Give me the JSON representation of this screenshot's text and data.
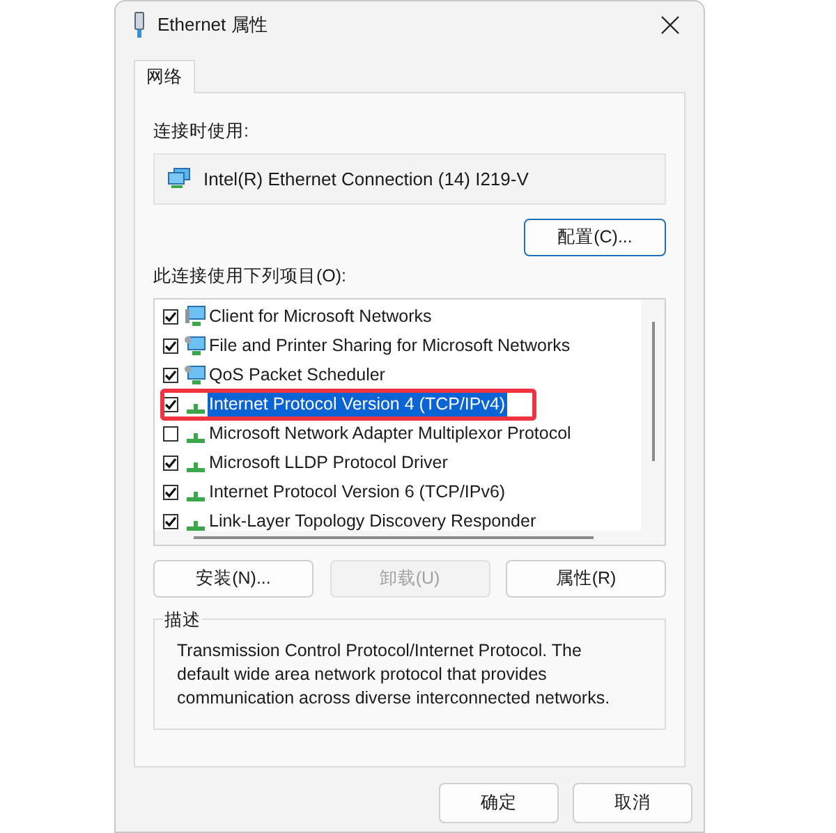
{
  "window": {
    "title": "Ethernet 属性"
  },
  "tabs": [
    {
      "label": "网络",
      "selected": true
    }
  ],
  "connect_using": {
    "label": "连接时使用:",
    "adapter": "Intel(R) Ethernet Connection (14) I219-V"
  },
  "configure_button": "配置(C)...",
  "items_label": "此连接使用下列项目(O):",
  "items": [
    {
      "label": "Client for Microsoft Networks",
      "kind": "client",
      "checked": true,
      "selected": false,
      "highlighted": false
    },
    {
      "label": "File and Printer Sharing for Microsoft Networks",
      "kind": "service",
      "checked": true,
      "selected": false,
      "highlighted": false
    },
    {
      "label": "QoS Packet Scheduler",
      "kind": "service",
      "checked": true,
      "selected": false,
      "highlighted": false
    },
    {
      "label": "Internet Protocol Version 4 (TCP/IPv4)",
      "kind": "protocol",
      "checked": true,
      "selected": true,
      "highlighted": true
    },
    {
      "label": "Microsoft Network Adapter Multiplexor Protocol",
      "kind": "protocol",
      "checked": false,
      "selected": false,
      "highlighted": false
    },
    {
      "label": "Microsoft LLDP Protocol Driver",
      "kind": "protocol",
      "checked": true,
      "selected": false,
      "highlighted": false
    },
    {
      "label": "Internet Protocol Version 6 (TCP/IPv6)",
      "kind": "protocol",
      "checked": true,
      "selected": false,
      "highlighted": false
    },
    {
      "label": "Link-Layer Topology Discovery Responder",
      "kind": "protocol",
      "checked": true,
      "selected": false,
      "highlighted": false
    }
  ],
  "item_buttons": [
    {
      "label": "安装(N)...",
      "disabled": false
    },
    {
      "label": "卸载(U)",
      "disabled": true
    },
    {
      "label": "属性(R)",
      "disabled": false
    }
  ],
  "description": {
    "label": "描述",
    "text": "Transmission Control Protocol/Internet Protocol. The default wide area network protocol that provides communication across diverse interconnected networks."
  },
  "footer_buttons": [
    {
      "label": "确定"
    },
    {
      "label": "取消"
    }
  ]
}
